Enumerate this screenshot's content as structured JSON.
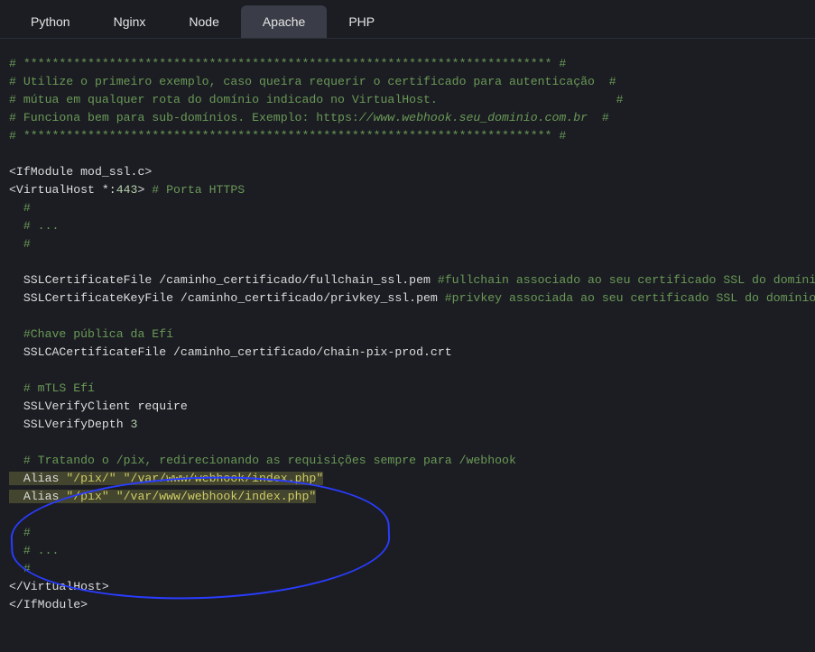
{
  "tabs": [
    {
      "label": "Python",
      "active": false
    },
    {
      "label": "Nginx",
      "active": false
    },
    {
      "label": "Node",
      "active": false
    },
    {
      "label": "Apache",
      "active": true
    },
    {
      "label": "PHP",
      "active": false
    }
  ],
  "code": {
    "hr": "# ************************************************************************** #",
    "c1": "# Utilize o primeiro exemplo, caso queira requerir o certificado para autenticação  #",
    "c2": "# mútua em qualquer rota do domínio indicado no VirtualHost.                         #",
    "c3a": "# Funciona bem para sub-domínios. Exemplo: https:",
    "c3b": "//www.webhook.seu_dominio.com.br",
    "c3c": "  #",
    "ifmod_open": "<IfModule mod_ssl.c>",
    "vh_open_a": "<VirtualHost *:",
    "vh_port": "443",
    "vh_open_b": "> ",
    "vh_open_c": "# Porta HTTPS",
    "ind_hash": "  #",
    "ind_dots": "  # ...",
    "ssl_cert": "  SSLCertificateFile /caminho_certificado/fullchain_ssl.pem ",
    "ssl_cert_c": "#fullchain associado ao seu certificado SSL do domínio",
    "ssl_key": "  SSLCertificateKeyFile /caminho_certificado/privkey_ssl.pem ",
    "ssl_key_c": "#privkey associada ao seu certificado SSL do domínio",
    "chave_c": "  #Chave pública da Efí",
    "sslca": "  SSLCACertificateFile /caminho_certificado/chain-pix-prod.crt",
    "mtls_c": "  # mTLS Efí",
    "verify": "  SSLVerifyClient require",
    "depth_a": "  SSLVerifyDepth ",
    "depth_n": "3",
    "tratando": "  # Tratando o /pix, redirecionando as requisições sempre para /webhook",
    "alias1_a": "  Alias ",
    "alias1_b": "\"/pix/\"",
    "alias1_c": " ",
    "alias1_d": "\"/var/www/webhook/index.php\"",
    "alias2_a": "  Alias ",
    "alias2_b": "\"/pix\"",
    "alias2_c": " ",
    "alias2_d": "\"/var/www/webhook/index.php\"",
    "vh_close": "</VirtualHost>",
    "ifmod_close": "</IfModule>"
  }
}
